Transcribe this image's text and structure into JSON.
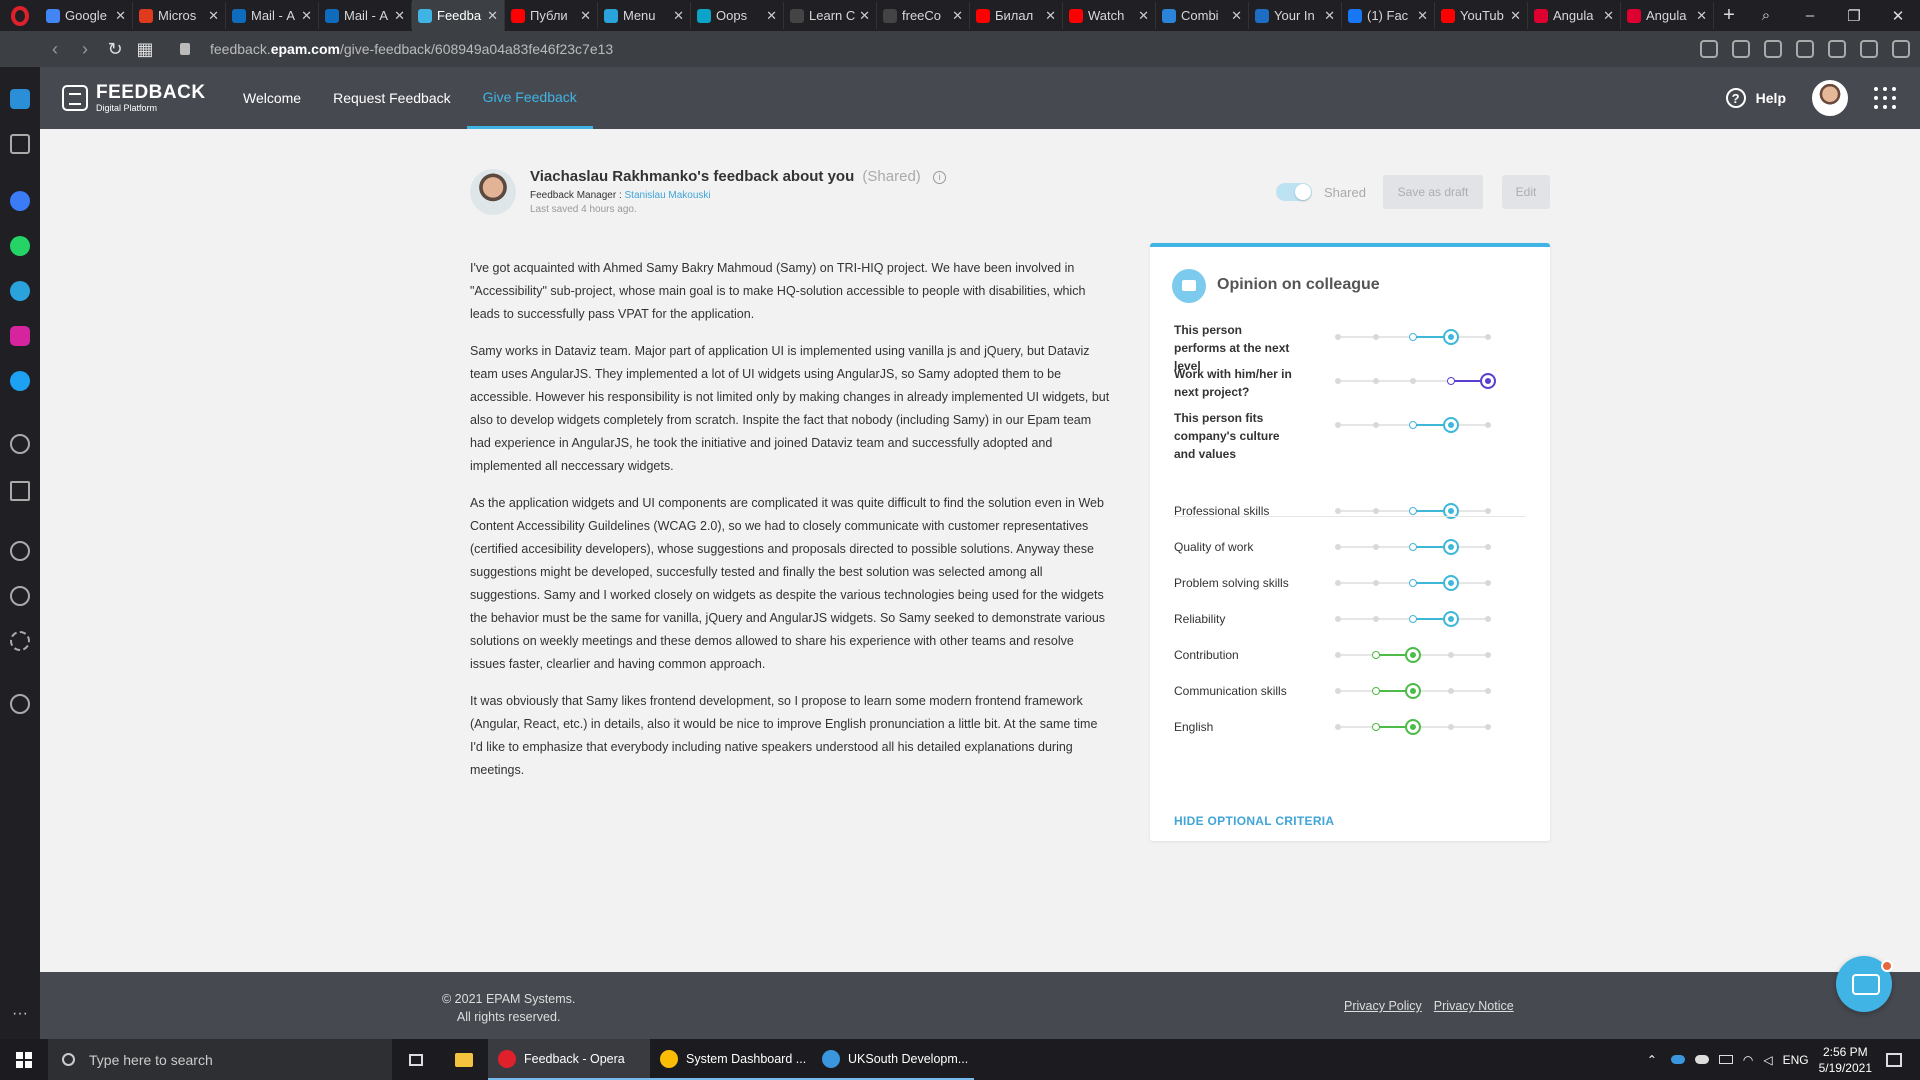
{
  "browser": {
    "tabs": [
      {
        "label": "Google",
        "color": "#4285f4",
        "active": false
      },
      {
        "label": "Micros",
        "color": "#e03a1e",
        "active": false
      },
      {
        "label": "Mail - А",
        "color": "#0f6cbd",
        "active": false
      },
      {
        "label": "Mail - А",
        "color": "#0f6cbd",
        "active": false
      },
      {
        "label": "Feedba",
        "color": "#40b4e5",
        "active": true
      },
      {
        "label": "Публи",
        "color": "#ff0000",
        "active": false
      },
      {
        "label": "Menu",
        "color": "#2aa3dc",
        "active": false
      },
      {
        "label": "Oops",
        "color": "#0aa4c8",
        "active": false
      },
      {
        "label": "Learn C",
        "color": "#444444",
        "active": false
      },
      {
        "label": "freeCo",
        "color": "#444444",
        "active": false
      },
      {
        "label": "Билал",
        "color": "#ff0000",
        "active": false
      },
      {
        "label": "Watch",
        "color": "#ff0000",
        "active": false
      },
      {
        "label": "Combi",
        "color": "#2a84d8",
        "active": false
      },
      {
        "label": "Your In",
        "color": "#1d6ec2",
        "active": false
      },
      {
        "label": "(1) Fac",
        "color": "#1877f2",
        "active": false
      },
      {
        "label": "YouTub",
        "color": "#ff0000",
        "active": false
      },
      {
        "label": "Angula",
        "color": "#dd0031",
        "active": false
      },
      {
        "label": "Angula",
        "color": "#dd0031",
        "active": false
      }
    ],
    "url_host": "feedback.",
    "url_domain": "epam.com",
    "url_path": "/give-feedback/608949a04a83fe46f23c7e13"
  },
  "app": {
    "logo_title": "FEEDBACK",
    "logo_subtitle": "Digital Platform",
    "nav": [
      "Welcome",
      "Request Feedback",
      "Give Feedback"
    ],
    "help_label": "Help"
  },
  "feedback": {
    "title": "Viachaslau Rakhmanko's feedback about you",
    "shared_tag": "(Shared)",
    "manager_label": "Feedback Manager :",
    "manager_name": "Stanislau Makouski",
    "saved": "Last saved 4 hours ago.",
    "toggle_label": "Shared",
    "save_draft": "Save as draft",
    "edit": "Edit",
    "paragraphs": [
      "I've got acquainted with Ahmed Samy Bakry Mahmoud (Samy) on TRI-HIQ project. We have been involved in \"Accessibility\" sub-project, whose main goal is to make HQ-solution accessible to people with disabilities, which leads to successfully pass VPAT for the application.",
      "Samy works in Dataviz team. Major part of application UI is implemented using vanilla js and jQuery, but Dataviz team uses AngularJS. They implemented a lot of UI widgets using AngularJS, so Samy adopted them to be accessible. However his responsibility is not limited only by making changes in already implemented UI widgets, but also to develop widgets completely from scratch. Inspite the fact that nobody (including Samy) in our Epam team had experience in AngularJS, he took the initiative and joined Dataviz team and successfully adopted and implemented all neccessary widgets.",
      "As the application widgets and UI components are complicated it was quite difficult to find the solution even in Web Content Accessibility Guildelines (WCAG 2.0), so we had to closely communicate with customer representatives (certified accesibility developers), whose suggestions and proposals directed to possible solutions. Anyway these suggestions might be developed, succesfully tested and finally the best solution was selected among all suggestions. Samy and I worked closely on widgets as despite the various technologies being used for the widgets the behavior must be the same for vanilla, jQuery and AngularJS widgets. So Samy seeked to demonstrate various solutions on weekly meetings and these demos allowed to share his experience with other teams and resolve issues faster, clearlier and having common approach.",
      "It was obviously that Samy likes frontend development, so I propose to learn some modern frontend framework (Angular, React, etc.) in details, also it would be nice to improve English pronunciation a little bit. At the same time I'd like to emphasize that everybody including native speakers understood all his detailed explanations during meetings."
    ]
  },
  "opinion": {
    "title": "Opinion on colleague",
    "main_criteria": [
      {
        "label": "This person performs at the next level",
        "level": 4,
        "color": "#3fb8d8"
      },
      {
        "label": "Work with him/her in next project?",
        "level": 5,
        "color": "#5b3fd0"
      },
      {
        "label": "This person fits company's culture and values",
        "level": 4,
        "color": "#3fb8d8"
      }
    ],
    "optional_criteria": [
      {
        "label": "Professional skills",
        "level": 4,
        "color": "#3fb8d8"
      },
      {
        "label": "Quality of work",
        "level": 4,
        "color": "#3fb8d8"
      },
      {
        "label": "Problem solving skills",
        "level": 4,
        "color": "#3fb8d8"
      },
      {
        "label": "Reliability",
        "level": 4,
        "color": "#3fb8d8"
      },
      {
        "label": "Contribution",
        "level": 3,
        "color": "#4cbb47"
      },
      {
        "label": "Communication skills",
        "level": 3,
        "color": "#4cbb47"
      },
      {
        "label": "English",
        "level": 3,
        "color": "#4cbb47"
      }
    ],
    "scale_max": 5,
    "hide_link": "HIDE OPTIONAL CRITERIA"
  },
  "footer": {
    "copyright_line1": "© 2021 EPAM Systems.",
    "copyright_line2": "All rights reserved.",
    "privacy_policy": "Privacy Policy",
    "privacy_notice": "Privacy Notice"
  },
  "taskbar": {
    "search_placeholder": "Type here to search",
    "apps": [
      {
        "label": "Feedback - Opera",
        "color": "#e0202a",
        "active": true
      },
      {
        "label": "System Dashboard ...",
        "color": "#fbbc05",
        "active": false
      },
      {
        "label": "UKSouth Developm...",
        "color": "#3a96dd",
        "active": false
      }
    ],
    "language": "ENG",
    "time": "2:56 PM",
    "date": "5/19/2021"
  }
}
